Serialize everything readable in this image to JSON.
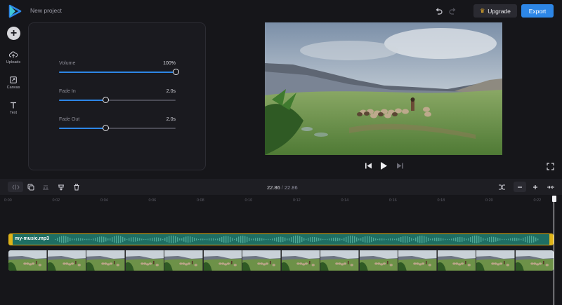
{
  "header": {
    "project_name": "New project",
    "upgrade_label": "Upgrade",
    "export_label": "Export",
    "icons": {
      "logo": "play-logo-icon",
      "undo": "undo-icon",
      "redo": "redo-icon",
      "crown": "crown-icon"
    }
  },
  "sidebar": {
    "items": [
      {
        "label": "Uploads",
        "icon": "upload-icon"
      },
      {
        "label": "Canvas",
        "icon": "canvas-icon"
      },
      {
        "label": "Text",
        "icon": "text-icon"
      }
    ]
  },
  "audio_panel": {
    "volume": {
      "label": "Volume",
      "value_text": "100%",
      "value": 1.0
    },
    "fade_in": {
      "label": "Fade In",
      "value_text": "2.0s",
      "value": 0.4
    },
    "fade_out": {
      "label": "Fade Out",
      "value_text": "2.0s",
      "value": 0.4
    }
  },
  "timeline": {
    "current_time": "22.86",
    "separator": "/",
    "duration": "22.86",
    "ticks": [
      "0:00",
      "0:02",
      "0:04",
      "0:06",
      "0:08",
      "0:10",
      "0:12",
      "0:14",
      "0:16",
      "0:18",
      "0:20",
      "0:22"
    ],
    "audio_clip_name": "my-music.mp3",
    "video_thumbnail_count": 14
  },
  "colors": {
    "accent": "#2d86e6",
    "audio_clip": "#1e6e63",
    "audio_border": "#e0b317",
    "background": "#16161a"
  }
}
